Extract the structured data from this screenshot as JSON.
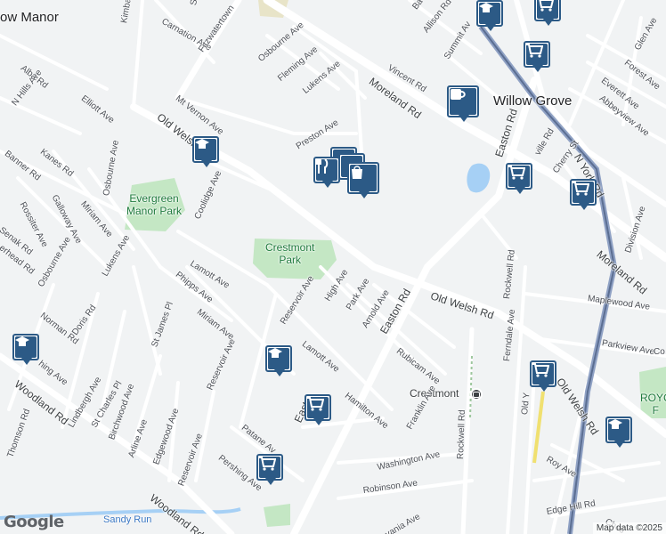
{
  "map": {
    "attribution": "Map data ©2025",
    "logo": "Google",
    "places": {
      "willow_grove": "Willow Grove",
      "crestmont": "Crestmont",
      "manor": "ow Manor"
    },
    "parks": {
      "evergreen": [
        "Evergreen",
        "Manor Park"
      ],
      "crestmont": [
        "Crestmont",
        "Park"
      ],
      "roy": [
        "ROYC",
        "F"
      ]
    },
    "water": {
      "sandy_run": "Sandy Run"
    },
    "streets": {
      "n_hills_ave": "N Hills Ave",
      "alba_rd": "Alba Rd",
      "elliott_ave": "Elliott Ave",
      "kimball": "Kimball",
      "carnation_ave": "Carnation Ave",
      "fitzwatertown": "Fitzwatertown",
      "osbourne_ave_top": "Osbourne Ave",
      "fleming_ave": "Fleming Ave",
      "lukens_ave_top": "Lukens Ave",
      "vincent_rd": "Vincent Rd",
      "allison_rd": "Allison Rd",
      "summit_av": "Summit Av",
      "moreland_rd_top": "Moreland Rd",
      "mt_vernon_ave": "Mt Vernon Ave",
      "old_welsh_rd_w": "Old Welsh Rd",
      "preston_ave": "Preston Ave",
      "banner_rd": "Banner Rd",
      "kanes_rd": "Kanes Rd",
      "galloway_ave": "Galloway Ave",
      "rossiter_ave": "Rossiter Ave",
      "senak_rd": "Senak Rd",
      "erhead_rd": "erhead Rd",
      "osbourne_ave_mid": "Osbourne Ave",
      "miriam_ave_w": "Miriam Ave",
      "coolidge_ave": "Coolidge Ave",
      "lukens_ave_mid": "Lukens Ave",
      "osbourne_ave_sw": "Osbourne Ave",
      "lamott_ave": "Lamott Ave",
      "phipps_ave": "Phipps Ave",
      "miriam_ave": "Miriam Ave",
      "reservoir_ave": "Reservoir Ave",
      "high_ave": "High Ave",
      "park_ave": "Park Ave",
      "arnold_ave": "Arnold Ave",
      "easton_rd": "Easton Rd",
      "old_welsh_rd_e": "Old Welsh Rd",
      "norman_rd": "Norman Rd",
      "doris_rd": "Doris Rd",
      "st_james_pl": "St James Pl",
      "lamott_ave_s": "Lamott Ave",
      "hing_ave": "hing Ave",
      "woodland_rd": "Woodland Rd",
      "lindbergh_ave": "Lindbergh Ave",
      "st_charles_pl": "St Charles Pl",
      "birchwood_ave": "Birchwood Ave",
      "reservoir_ave_s": "Reservoir Ave",
      "thomson_rd": "Thomson Rd",
      "arline_ave": "Arline Ave",
      "edgewood_ave": "Edgewood Ave",
      "reservoir_ave_sw": "Reservoir Ave",
      "rubicam_ave": "Rubicam Ave",
      "hamilton_ave": "Hamilton Ave",
      "easton_s": "East",
      "patane_av": "Patane Av",
      "pershing_ave": "Pershing Ave",
      "woodland_rd_s": "Woodland Rd",
      "franklin_ave": "Franklin Ave",
      "washington_ave": "Washington Ave",
      "robinson_ave": "Robinson Ave",
      "rockwell_rd": "Rockwell Rd",
      "rockwell_rd_n": "Rockwell Rd",
      "ferndale_ave": "Ferndale Ave",
      "old_york": "Old Y",
      "old_welsh_rd_se": "Old Welsh Rd",
      "roy_ave": "Roy Ave",
      "edge_hill_rd": "Edge Hill Rd",
      "maplewood_ave": "Maplewood Ave",
      "parkview_ave": "Parkview Ave",
      "moreland_rd_e": "Moreland Rd",
      "division_ave": "Division Ave",
      "ny_york_rd": "N York Rd",
      "easton_rd_n": "Easton Rd",
      "ville_rd": "ville Rd",
      "cherry_st": "Cherry St",
      "everett_ave": "Everett Ave",
      "forest_ave": "Forest Ave",
      "abbeyview_ave": "Abbeyview Ave",
      "glen_ave": "Glen Ave",
      "co": "Co",
      "vania_ave": "vania Ave",
      "ches": "Ches",
      "map_data": "Map data",
      "sn": "Sn",
      "ba": "Ba"
    },
    "pins": [
      {
        "id": "school-1",
        "icon": "school-icon"
      },
      {
        "id": "school-2",
        "icon": "school-icon"
      },
      {
        "id": "school-3",
        "icon": "school-icon"
      },
      {
        "id": "school-4",
        "icon": "school-icon"
      },
      {
        "id": "school-5",
        "icon": "school-icon"
      },
      {
        "id": "restaurant-1",
        "icon": "restaurant-icon"
      },
      {
        "id": "shopping-1",
        "icon": "shopping-bag-icon"
      },
      {
        "id": "cafe-1",
        "icon": "cafe-icon"
      },
      {
        "id": "grocery-1",
        "icon": "shopping-cart-icon"
      },
      {
        "id": "grocery-2",
        "icon": "shopping-cart-icon"
      },
      {
        "id": "grocery-3",
        "icon": "shopping-cart-icon"
      },
      {
        "id": "grocery-4",
        "icon": "shopping-cart-icon"
      },
      {
        "id": "grocery-5",
        "icon": "shopping-cart-icon"
      },
      {
        "id": "grocery-6",
        "icon": "shopping-cart-icon"
      },
      {
        "id": "grocery-7",
        "icon": "shopping-cart-icon"
      }
    ],
    "colors": {
      "background": "#f1f3f4",
      "road": "#ffffff",
      "park": "#c4e7c4",
      "water": "#a6d0f5",
      "rail": "#5b6e92",
      "pin": "#2c5a86"
    }
  }
}
